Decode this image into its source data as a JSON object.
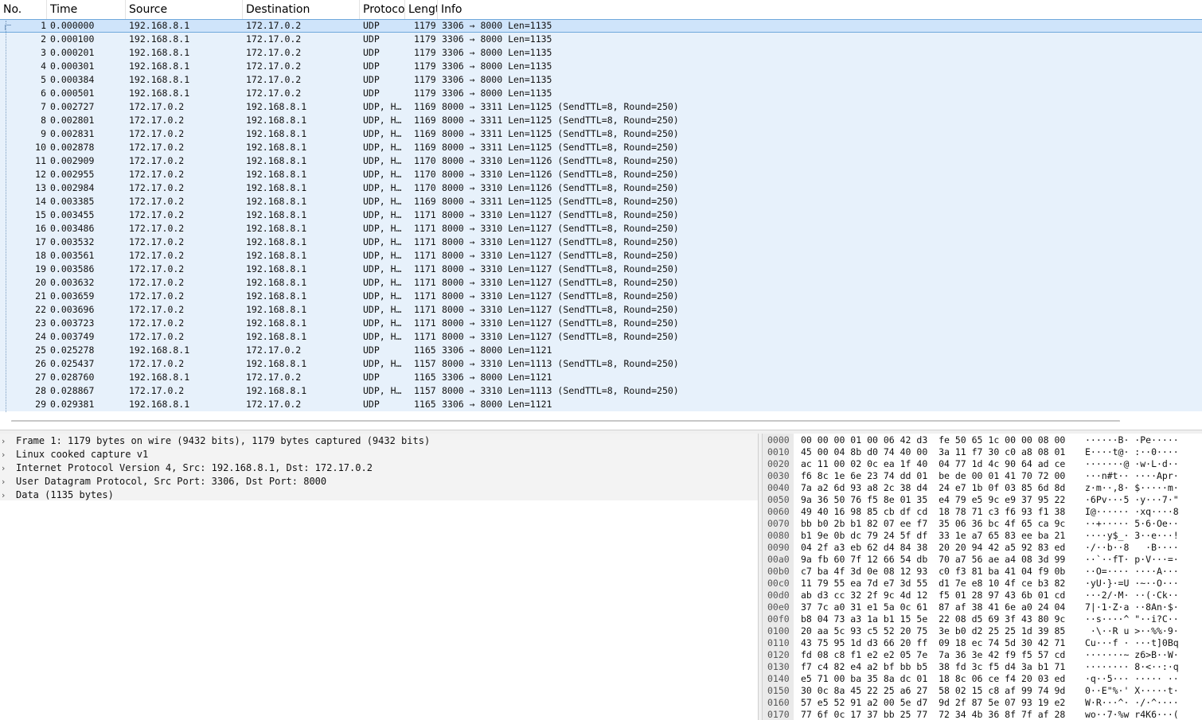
{
  "packet_list": {
    "columns": [
      "No.",
      "Time",
      "Source",
      "Destination",
      "Protoco",
      "Lengt",
      "Info"
    ],
    "rows": [
      {
        "no": "1",
        "time": "0.000000",
        "src": "192.168.8.1",
        "dst": "172.17.0.2",
        "proto": "UDP",
        "len": "1179",
        "info": "3306 → 8000 Len=1135"
      },
      {
        "no": "2",
        "time": "0.000100",
        "src": "192.168.8.1",
        "dst": "172.17.0.2",
        "proto": "UDP",
        "len": "1179",
        "info": "3306 → 8000 Len=1135"
      },
      {
        "no": "3",
        "time": "0.000201",
        "src": "192.168.8.1",
        "dst": "172.17.0.2",
        "proto": "UDP",
        "len": "1179",
        "info": "3306 → 8000 Len=1135"
      },
      {
        "no": "4",
        "time": "0.000301",
        "src": "192.168.8.1",
        "dst": "172.17.0.2",
        "proto": "UDP",
        "len": "1179",
        "info": "3306 → 8000 Len=1135"
      },
      {
        "no": "5",
        "time": "0.000384",
        "src": "192.168.8.1",
        "dst": "172.17.0.2",
        "proto": "UDP",
        "len": "1179",
        "info": "3306 → 8000 Len=1135"
      },
      {
        "no": "6",
        "time": "0.000501",
        "src": "192.168.8.1",
        "dst": "172.17.0.2",
        "proto": "UDP",
        "len": "1179",
        "info": "3306 → 8000 Len=1135"
      },
      {
        "no": "7",
        "time": "0.002727",
        "src": "172.17.0.2",
        "dst": "192.168.8.1",
        "proto": "UDP, H…",
        "len": "1169",
        "info": "8000 → 3311 Len=1125 (SendTTL=8, Round=250)"
      },
      {
        "no": "8",
        "time": "0.002801",
        "src": "172.17.0.2",
        "dst": "192.168.8.1",
        "proto": "UDP, H…",
        "len": "1169",
        "info": "8000 → 3311 Len=1125 (SendTTL=8, Round=250)"
      },
      {
        "no": "9",
        "time": "0.002831",
        "src": "172.17.0.2",
        "dst": "192.168.8.1",
        "proto": "UDP, H…",
        "len": "1169",
        "info": "8000 → 3311 Len=1125 (SendTTL=8, Round=250)"
      },
      {
        "no": "10",
        "time": "0.002878",
        "src": "172.17.0.2",
        "dst": "192.168.8.1",
        "proto": "UDP, H…",
        "len": "1169",
        "info": "8000 → 3311 Len=1125 (SendTTL=8, Round=250)"
      },
      {
        "no": "11",
        "time": "0.002909",
        "src": "172.17.0.2",
        "dst": "192.168.8.1",
        "proto": "UDP, H…",
        "len": "1170",
        "info": "8000 → 3310 Len=1126 (SendTTL=8, Round=250)"
      },
      {
        "no": "12",
        "time": "0.002955",
        "src": "172.17.0.2",
        "dst": "192.168.8.1",
        "proto": "UDP, H…",
        "len": "1170",
        "info": "8000 → 3310 Len=1126 (SendTTL=8, Round=250)"
      },
      {
        "no": "13",
        "time": "0.002984",
        "src": "172.17.0.2",
        "dst": "192.168.8.1",
        "proto": "UDP, H…",
        "len": "1170",
        "info": "8000 → 3310 Len=1126 (SendTTL=8, Round=250)"
      },
      {
        "no": "14",
        "time": "0.003385",
        "src": "172.17.0.2",
        "dst": "192.168.8.1",
        "proto": "UDP, H…",
        "len": "1169",
        "info": "8000 → 3311 Len=1125 (SendTTL=8, Round=250)"
      },
      {
        "no": "15",
        "time": "0.003455",
        "src": "172.17.0.2",
        "dst": "192.168.8.1",
        "proto": "UDP, H…",
        "len": "1171",
        "info": "8000 → 3310 Len=1127 (SendTTL=8, Round=250)"
      },
      {
        "no": "16",
        "time": "0.003486",
        "src": "172.17.0.2",
        "dst": "192.168.8.1",
        "proto": "UDP, H…",
        "len": "1171",
        "info": "8000 → 3310 Len=1127 (SendTTL=8, Round=250)"
      },
      {
        "no": "17",
        "time": "0.003532",
        "src": "172.17.0.2",
        "dst": "192.168.8.1",
        "proto": "UDP, H…",
        "len": "1171",
        "info": "8000 → 3310 Len=1127 (SendTTL=8, Round=250)"
      },
      {
        "no": "18",
        "time": "0.003561",
        "src": "172.17.0.2",
        "dst": "192.168.8.1",
        "proto": "UDP, H…",
        "len": "1171",
        "info": "8000 → 3310 Len=1127 (SendTTL=8, Round=250)"
      },
      {
        "no": "19",
        "time": "0.003586",
        "src": "172.17.0.2",
        "dst": "192.168.8.1",
        "proto": "UDP, H…",
        "len": "1171",
        "info": "8000 → 3310 Len=1127 (SendTTL=8, Round=250)"
      },
      {
        "no": "20",
        "time": "0.003632",
        "src": "172.17.0.2",
        "dst": "192.168.8.1",
        "proto": "UDP, H…",
        "len": "1171",
        "info": "8000 → 3310 Len=1127 (SendTTL=8, Round=250)"
      },
      {
        "no": "21",
        "time": "0.003659",
        "src": "172.17.0.2",
        "dst": "192.168.8.1",
        "proto": "UDP, H…",
        "len": "1171",
        "info": "8000 → 3310 Len=1127 (SendTTL=8, Round=250)"
      },
      {
        "no": "22",
        "time": "0.003696",
        "src": "172.17.0.2",
        "dst": "192.168.8.1",
        "proto": "UDP, H…",
        "len": "1171",
        "info": "8000 → 3310 Len=1127 (SendTTL=8, Round=250)"
      },
      {
        "no": "23",
        "time": "0.003723",
        "src": "172.17.0.2",
        "dst": "192.168.8.1",
        "proto": "UDP, H…",
        "len": "1171",
        "info": "8000 → 3310 Len=1127 (SendTTL=8, Round=250)"
      },
      {
        "no": "24",
        "time": "0.003749",
        "src": "172.17.0.2",
        "dst": "192.168.8.1",
        "proto": "UDP, H…",
        "len": "1171",
        "info": "8000 → 3310 Len=1127 (SendTTL=8, Round=250)"
      },
      {
        "no": "25",
        "time": "0.025278",
        "src": "192.168.8.1",
        "dst": "172.17.0.2",
        "proto": "UDP",
        "len": "1165",
        "info": "3306 → 8000 Len=1121"
      },
      {
        "no": "26",
        "time": "0.025437",
        "src": "172.17.0.2",
        "dst": "192.168.8.1",
        "proto": "UDP, H…",
        "len": "1157",
        "info": "8000 → 3310 Len=1113 (SendTTL=8, Round=250)"
      },
      {
        "no": "27",
        "time": "0.028760",
        "src": "192.168.8.1",
        "dst": "172.17.0.2",
        "proto": "UDP",
        "len": "1165",
        "info": "3306 → 8000 Len=1121"
      },
      {
        "no": "28",
        "time": "0.028867",
        "src": "172.17.0.2",
        "dst": "192.168.8.1",
        "proto": "UDP, H…",
        "len": "1157",
        "info": "8000 → 3310 Len=1113 (SendTTL=8, Round=250)"
      },
      {
        "no": "29",
        "time": "0.029381",
        "src": "192.168.8.1",
        "dst": "172.17.0.2",
        "proto": "UDP",
        "len": "1165",
        "info": "3306 → 8000 Len=1121"
      }
    ]
  },
  "details": {
    "items": [
      "Frame 1: 1179 bytes on wire (9432 bits), 1179 bytes captured (9432 bits)",
      "Linux cooked capture v1",
      "Internet Protocol Version 4, Src: 192.168.8.1, Dst: 172.17.0.2",
      "User Datagram Protocol, Src Port: 3306, Dst Port: 8000",
      "Data (1135 bytes)"
    ]
  },
  "hex": {
    "rows": [
      {
        "off": "0000",
        "bytes": "00 00 00 01 00 06 42 d3  fe 50 65 1c 00 00 08 00",
        "ascii": "······B· ·Pe·····"
      },
      {
        "off": "0010",
        "bytes": "45 00 04 8b d0 74 40 00  3a 11 f7 30 c0 a8 08 01",
        "ascii": "E····t@· :··0····"
      },
      {
        "off": "0020",
        "bytes": "ac 11 00 02 0c ea 1f 40  04 77 1d 4c 90 64 ad ce",
        "ascii": "·······@ ·w·L·d··"
      },
      {
        "off": "0030",
        "bytes": "f6 8c 1e 6e 23 74 dd 01  be de 00 01 41 70 72 00",
        "ascii": "···n#t·· ····Apr·"
      },
      {
        "off": "0040",
        "bytes": "7a a2 6d 93 a8 2c 38 d4  24 e7 1b 0f 03 85 6d 8d",
        "ascii": "z·m··,8· $·····m·"
      },
      {
        "off": "0050",
        "bytes": "9a 36 50 76 f5 8e 01 35  e4 79 e5 9c e9 37 95 22",
        "ascii": "·6Pv···5 ·y···7·\""
      },
      {
        "off": "0060",
        "bytes": "49 40 16 98 85 cb df cd  18 78 71 c3 f6 93 f1 38",
        "ascii": "I@······ ·xq····8"
      },
      {
        "off": "0070",
        "bytes": "bb b0 2b b1 82 07 ee f7  35 06 36 bc 4f 65 ca 9c",
        "ascii": "··+····· 5·6·Oe··"
      },
      {
        "off": "0080",
        "bytes": "b1 9e 0b dc 79 24 5f df  33 1e a7 65 83 ee ba 21",
        "ascii": "····y$_· 3··e···!"
      },
      {
        "off": "0090",
        "bytes": "04 2f a3 eb 62 d4 84 38  20 20 94 42 a5 92 83 ed",
        "ascii": "·/··b··8   ·B····"
      },
      {
        "off": "00a0",
        "bytes": "9a fb 60 7f 12 66 54 db  70 a7 56 ae a4 08 3d 99",
        "ascii": "··`··fT· p·V···=·"
      },
      {
        "off": "00b0",
        "bytes": "c7 ba 4f 3d 0e 08 12 93  c0 f3 81 ba 41 04 f9 0b",
        "ascii": "··O=···· ····A···"
      },
      {
        "off": "00c0",
        "bytes": "11 79 55 ea 7d e7 3d 55  d1 7e e8 10 4f ce b3 82",
        "ascii": "·yU·}·=U ·~··O···"
      },
      {
        "off": "00d0",
        "bytes": "ab d3 cc 32 2f 9c 4d 12  f5 01 28 97 43 6b 01 cd",
        "ascii": "···2/·M· ··(·Ck··"
      },
      {
        "off": "00e0",
        "bytes": "37 7c a0 31 e1 5a 0c 61  87 af 38 41 6e a0 24 04",
        "ascii": "7|·1·Z·a ··8An·$·"
      },
      {
        "off": "00f0",
        "bytes": "b8 04 73 a3 1a b1 15 5e  22 08 d5 69 3f 43 80 9c",
        "ascii": "··s····^ \"··i?C··"
      },
      {
        "off": "0100",
        "bytes": "20 aa 5c 93 c5 52 20 75  3e b0 d2 25 25 1d 39 85",
        "ascii": " ·\\··R u >··%%·9·"
      },
      {
        "off": "0110",
        "bytes": "43 75 95 1d d3 66 20 ff  09 18 ec 74 5d 30 42 71",
        "ascii": "Cu···f · ···t]0Bq"
      },
      {
        "off": "0120",
        "bytes": "fd 08 c8 f1 e2 e2 05 7e  7a 36 3e 42 f9 f5 57 cd",
        "ascii": "·······~ z6>B··W·"
      },
      {
        "off": "0130",
        "bytes": "f7 c4 82 e4 a2 bf bb b5  38 fd 3c f5 d4 3a b1 71",
        "ascii": "········ 8·<··:·q"
      },
      {
        "off": "0140",
        "bytes": "e5 71 00 ba 35 8a dc 01  18 8c 06 ce f4 20 03 ed",
        "ascii": "·q··5··· ····· ··"
      },
      {
        "off": "0150",
        "bytes": "30 0c 8a 45 22 25 a6 27  58 02 15 c8 af 99 74 9d",
        "ascii": "0··E\"%·' X·····t·"
      },
      {
        "off": "0160",
        "bytes": "57 e5 52 91 a2 00 5e d7  9d 2f 87 5e 07 93 19 e2",
        "ascii": "W·R···^· ·/·^····"
      },
      {
        "off": "0170",
        "bytes": "77 6f 0c 17 37 bb 25 77  72 34 4b 36 8f 7f af 28",
        "ascii": "wo··7·%w r4K6···("
      }
    ]
  },
  "colors": {
    "row_bg": "#e7f1fb",
    "selected_row_bg": "#cfe4fa",
    "selection_border": "#6fa8dc"
  }
}
